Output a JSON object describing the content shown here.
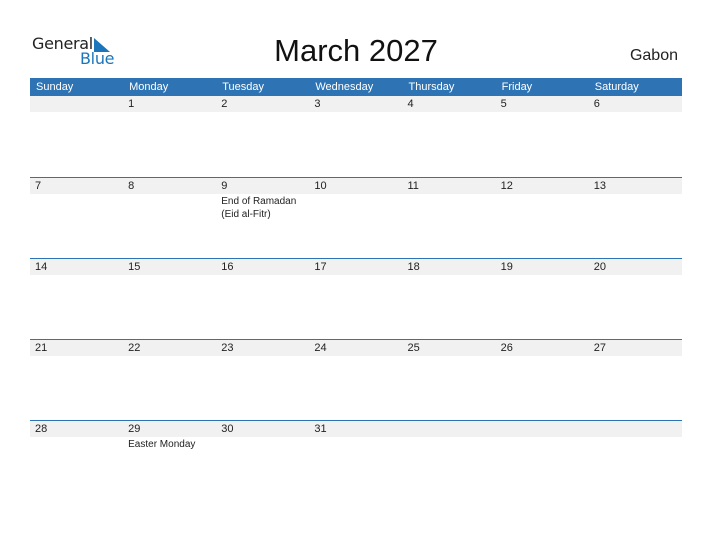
{
  "logo": {
    "general": "General",
    "blue": "Blue"
  },
  "title": "March 2027",
  "country": "Gabon",
  "colors": {
    "header_bg": "#2e74b5",
    "date_strip": "#f1f1f1",
    "logo_blue": "#1b75bb"
  },
  "weekdays": [
    "Sunday",
    "Monday",
    "Tuesday",
    "Wednesday",
    "Thursday",
    "Friday",
    "Saturday"
  ],
  "weeks": [
    [
      {
        "day": "",
        "event": ""
      },
      {
        "day": "1",
        "event": ""
      },
      {
        "day": "2",
        "event": ""
      },
      {
        "day": "3",
        "event": ""
      },
      {
        "day": "4",
        "event": ""
      },
      {
        "day": "5",
        "event": ""
      },
      {
        "day": "6",
        "event": ""
      }
    ],
    [
      {
        "day": "7",
        "event": ""
      },
      {
        "day": "8",
        "event": ""
      },
      {
        "day": "9",
        "event": "End of Ramadan (Eid al-Fitr)"
      },
      {
        "day": "10",
        "event": ""
      },
      {
        "day": "11",
        "event": ""
      },
      {
        "day": "12",
        "event": ""
      },
      {
        "day": "13",
        "event": ""
      }
    ],
    [
      {
        "day": "14",
        "event": ""
      },
      {
        "day": "15",
        "event": ""
      },
      {
        "day": "16",
        "event": ""
      },
      {
        "day": "17",
        "event": ""
      },
      {
        "day": "18",
        "event": ""
      },
      {
        "day": "19",
        "event": ""
      },
      {
        "day": "20",
        "event": ""
      }
    ],
    [
      {
        "day": "21",
        "event": ""
      },
      {
        "day": "22",
        "event": ""
      },
      {
        "day": "23",
        "event": ""
      },
      {
        "day": "24",
        "event": ""
      },
      {
        "day": "25",
        "event": ""
      },
      {
        "day": "26",
        "event": ""
      },
      {
        "day": "27",
        "event": ""
      }
    ],
    [
      {
        "day": "28",
        "event": ""
      },
      {
        "day": "29",
        "event": "Easter Monday"
      },
      {
        "day": "30",
        "event": ""
      },
      {
        "day": "31",
        "event": ""
      },
      {
        "day": "",
        "event": ""
      },
      {
        "day": "",
        "event": ""
      },
      {
        "day": "",
        "event": ""
      }
    ]
  ]
}
